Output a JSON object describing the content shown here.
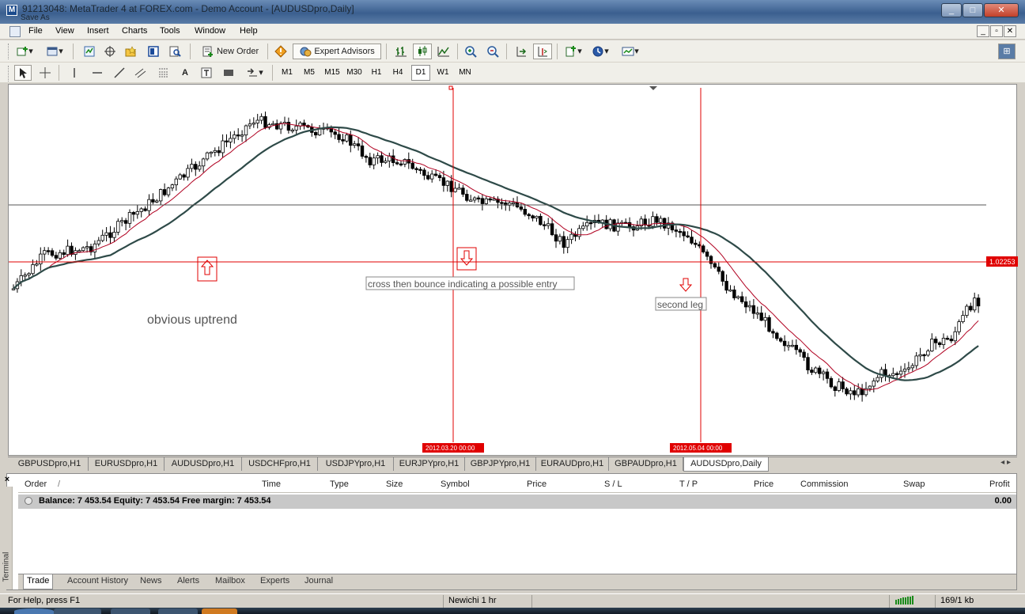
{
  "window": {
    "title": "91213048: MetaTrader 4 at FOREX.com - Demo Account - [AUDUSDpro,Daily]",
    "subtitle": "Save As",
    "app_icon": "metatrader-icon"
  },
  "menu": {
    "items": [
      "File",
      "View",
      "Insert",
      "Charts",
      "Tools",
      "Window",
      "Help"
    ]
  },
  "toolbar": {
    "new_order_label": "New Order",
    "expert_advisors_label": "Expert Advisors",
    "timeframes": [
      "M1",
      "M5",
      "M15",
      "M30",
      "H1",
      "H4",
      "D1",
      "W1",
      "MN"
    ],
    "active_timeframe": "D1",
    "text_tool_label": "A"
  },
  "chart": {
    "symbol": "AUDUSDpro",
    "period": "Daily",
    "price_label": "1.02253",
    "vline_labels": [
      "2012.03.20 00:00",
      "2012.05.04 00:00"
    ],
    "annotations": {
      "uptrend": "obvious uptrend",
      "entry": "cross then bounce indicating a possible entry",
      "second_leg": "second leg"
    },
    "colors": {
      "fast_ma": "#b00020",
      "slow_ma": "#2e4a48",
      "price_line": "#e00000",
      "vline": "#e00000"
    }
  },
  "chart_tabs": {
    "items": [
      "GBPUSDpro,H1",
      "EURUSDpro,H1",
      "AUDUSDpro,H1",
      "USDCHFpro,H1",
      "USDJPYpro,H1",
      "EURJPYpro,H1",
      "GBPJPYpro,H1",
      "EURAUDpro,H1",
      "GBPAUDpro,H1",
      "AUDUSDpro,Daily"
    ],
    "active": "AUDUSDpro,Daily"
  },
  "terminal": {
    "side_label": "Terminal",
    "columns": [
      "Order",
      "Time",
      "Type",
      "Size",
      "Symbol",
      "Price",
      "S / L",
      "T / P",
      "Price",
      "Commission",
      "Swap",
      "Profit"
    ],
    "sort_indicator": "/",
    "balance_text": "Balance: 7 453.54  Equity: 7 453.54  Free margin: 7 453.54",
    "balance_profit": "0.00",
    "tabs": [
      "Trade",
      "Account History",
      "News",
      "Alerts",
      "Mailbox",
      "Experts",
      "Journal"
    ],
    "active_tab": "Trade"
  },
  "status": {
    "help": "For Help, press F1",
    "profile": "Newichi 1 hr",
    "traffic": "169/1 kb"
  }
}
